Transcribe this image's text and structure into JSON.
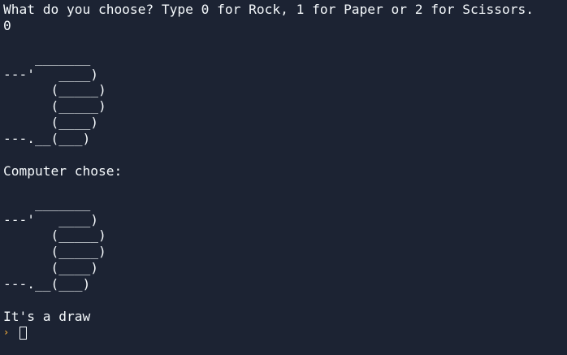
{
  "terminal": {
    "colors": {
      "background": "#1c2333",
      "text": "#f5f9fc",
      "prompt": "#e3a23b"
    },
    "lines": [
      "What do you choose? Type 0 for Rock, 1 for Paper or 2 for Scissors.",
      "0",
      "",
      "    _______",
      "---'   ____)",
      "      (_____)",
      "      (_____)",
      "      (____)",
      "---.__(___)",
      "",
      "Computer chose:",
      "",
      "    _______",
      "---'   ____)",
      "      (_____)",
      "      (_____)",
      "      (____)",
      "---.__(___)",
      "",
      "It's a draw"
    ],
    "prompt_icon": "chevron-right-icon",
    "prompt_symbol": "›"
  }
}
